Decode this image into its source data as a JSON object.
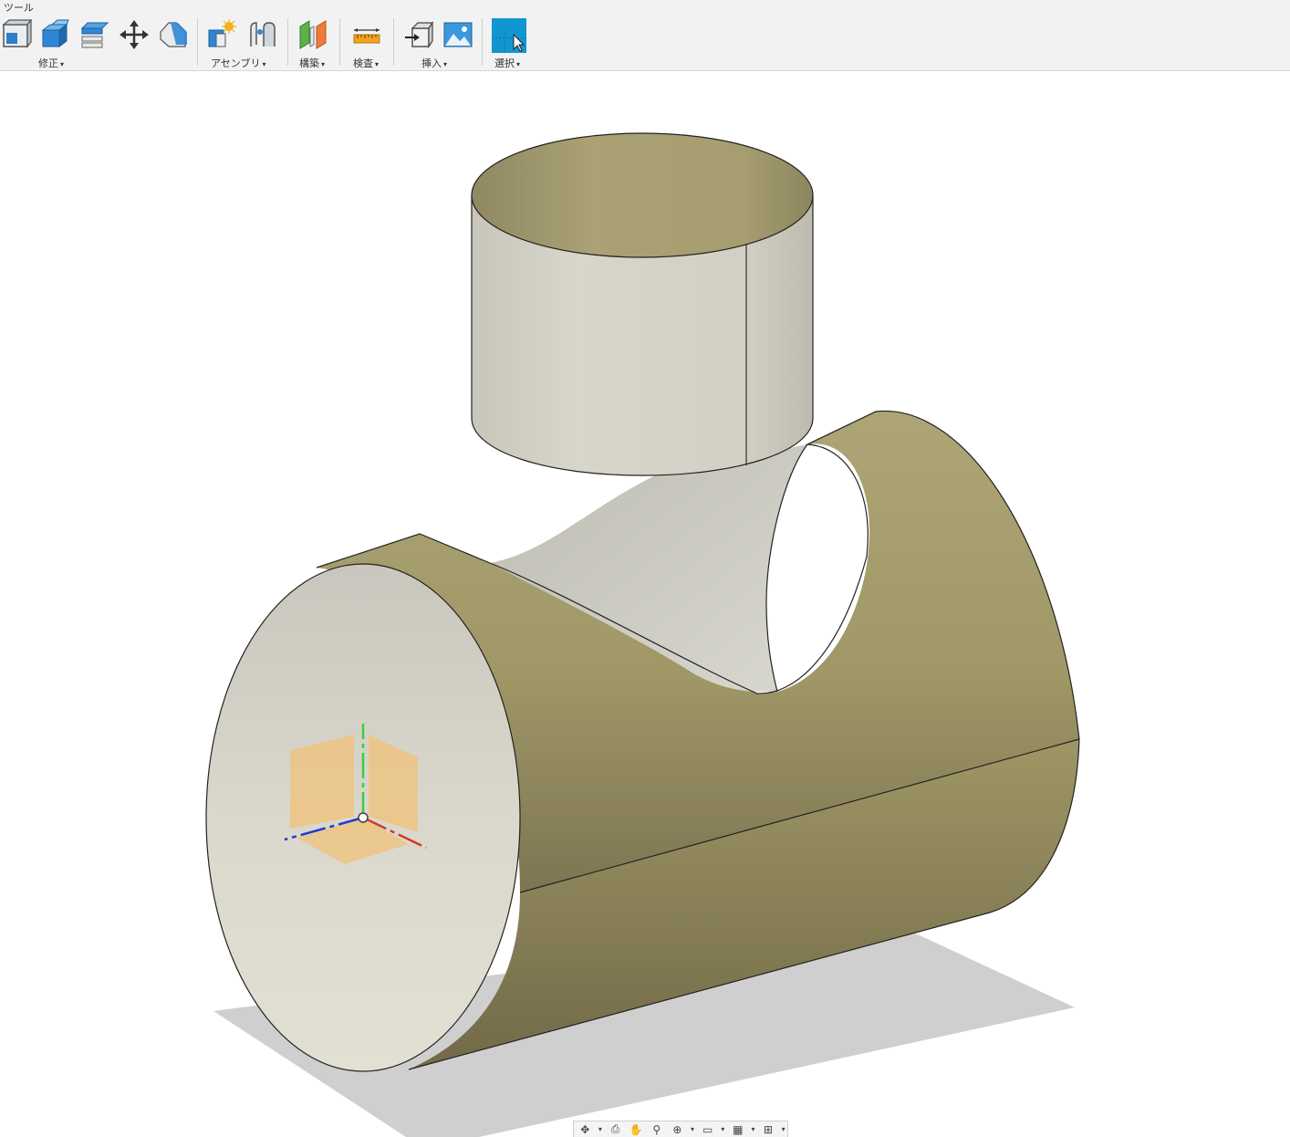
{
  "toolbar": {
    "tab_title": "ツール",
    "groups": {
      "modify": "修正",
      "assemble": "アセンブリ",
      "construct": "構築",
      "inspect": "検査",
      "insert": "挿入",
      "select": "選択"
    },
    "caret": "▾"
  },
  "colors": {
    "surface_tan": "#a8a06e",
    "surface_light": "#d8d6ca",
    "shadow": "#cfcfcf",
    "select_blue": "#1296d1",
    "axis_x": "#d23a2a",
    "axis_y": "#3ccf3c",
    "axis_z": "#1a3ad8",
    "origin_planes": "#f0c27a"
  },
  "navbar": {
    "icons": [
      "orbit-icon",
      "look-at-icon",
      "pan-icon",
      "zoom-icon",
      "fit-icon",
      "display-settings-icon",
      "grid-icon",
      "viewports-icon"
    ]
  }
}
